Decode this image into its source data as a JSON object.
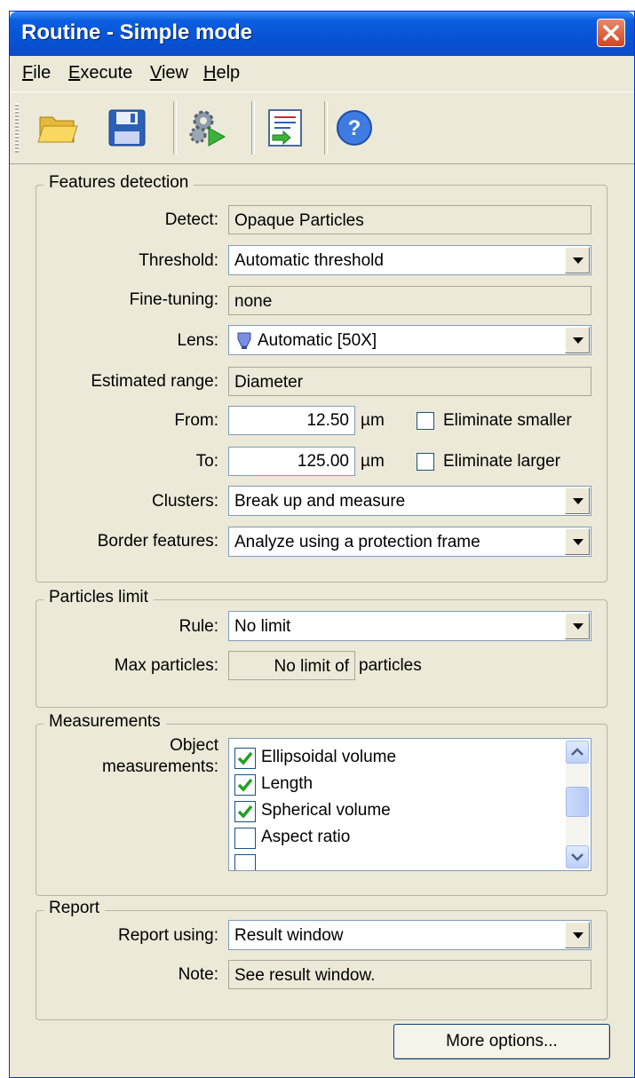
{
  "window": {
    "title": "Routine - Simple mode"
  },
  "menu": {
    "file": {
      "u": "F",
      "rest": "ile"
    },
    "execute": {
      "u": "E",
      "rest": "xecute"
    },
    "view": {
      "u": "V",
      "rest": "iew"
    },
    "help": {
      "u": "H",
      "rest": "elp"
    }
  },
  "toolbar": {
    "icons": [
      "open-folder-icon",
      "save-disk-icon",
      "run-gears-icon",
      "import-list-icon",
      "help-icon"
    ]
  },
  "features": {
    "legend": "Features detection",
    "detect_label": "Detect:",
    "detect_value": "Opaque Particles",
    "threshold_label": "Threshold:",
    "threshold_value": "Automatic threshold",
    "finetuning_label": "Fine-tuning:",
    "finetuning_value": "none",
    "lens_label": "Lens:",
    "lens_value": "Automatic [50X]",
    "range_label": "Estimated range:",
    "range_value": "Diameter",
    "from_label": "From:",
    "from_value": "12.50",
    "from_unit": "µm",
    "eliminate_smaller": "Eliminate smaller",
    "to_label": "To:",
    "to_value": "125.00",
    "to_unit": "µm",
    "eliminate_larger": "Eliminate larger",
    "clusters_label": "Clusters:",
    "clusters_value": "Break up and measure",
    "border_label": "Border features:",
    "border_value": "Analyze using a protection frame"
  },
  "particles": {
    "legend": "Particles limit",
    "rule_label": "Rule:",
    "rule_value": "No limit",
    "max_label": "Max particles:",
    "max_value": "No limit of",
    "max_suffix": "particles"
  },
  "measurements": {
    "legend": "Measurements",
    "label_line1": "Object",
    "label_line2": "measurements:",
    "items": [
      {
        "label": "Ellipsoidal volume",
        "checked": true
      },
      {
        "label": "Length",
        "checked": true
      },
      {
        "label": "Spherical volume",
        "checked": true
      },
      {
        "label": "Aspect ratio",
        "checked": false
      }
    ]
  },
  "report": {
    "legend": "Report",
    "using_label": "Report using:",
    "using_value": "Result window",
    "note_label": "Note:",
    "note_value": "See result window."
  },
  "buttons": {
    "more_options": "More options..."
  },
  "colors": {
    "title_bar": "#0853d6",
    "dialog_bg": "#ECE9D8",
    "check_green": "#21a121",
    "close_red": "#d2461f"
  }
}
